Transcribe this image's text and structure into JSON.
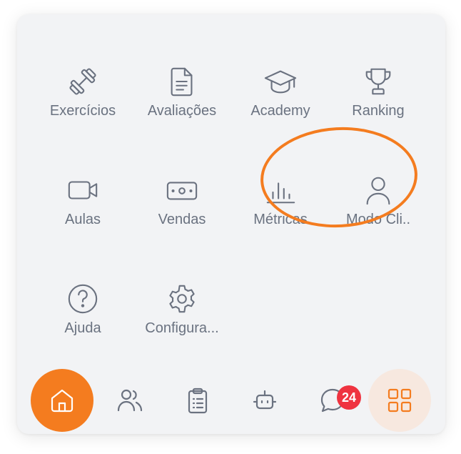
{
  "menu": {
    "items": [
      {
        "label": "Exercícios",
        "icon": "dumbbell-icon"
      },
      {
        "label": "Avaliações",
        "icon": "document-icon"
      },
      {
        "label": "Academy",
        "icon": "graduation-cap-icon"
      },
      {
        "label": "Ranking",
        "icon": "trophy-icon"
      },
      {
        "label": "Aulas",
        "icon": "video-camera-icon"
      },
      {
        "label": "Vendas",
        "icon": "banknote-icon"
      },
      {
        "label": "Métricas",
        "icon": "bar-chart-icon"
      },
      {
        "label": "Modo Cli..",
        "icon": "user-icon"
      },
      {
        "label": "Ajuda",
        "icon": "help-circle-icon"
      },
      {
        "label": "Configura...",
        "icon": "gear-icon"
      }
    ]
  },
  "bottom_nav": {
    "items": [
      {
        "name": "home",
        "icon": "home-icon",
        "active": true
      },
      {
        "name": "people",
        "icon": "users-icon"
      },
      {
        "name": "clipboard",
        "icon": "clipboard-icon"
      },
      {
        "name": "bot",
        "icon": "robot-icon"
      },
      {
        "name": "chat",
        "icon": "chat-bubble-icon",
        "badge": "24"
      },
      {
        "name": "apps",
        "icon": "grid-icon",
        "selected": true
      }
    ]
  },
  "colors": {
    "accent": "#f47c1f",
    "icon_gray": "#6b7280",
    "badge_red": "#ef3340",
    "card_bg": "#f2f3f5"
  }
}
